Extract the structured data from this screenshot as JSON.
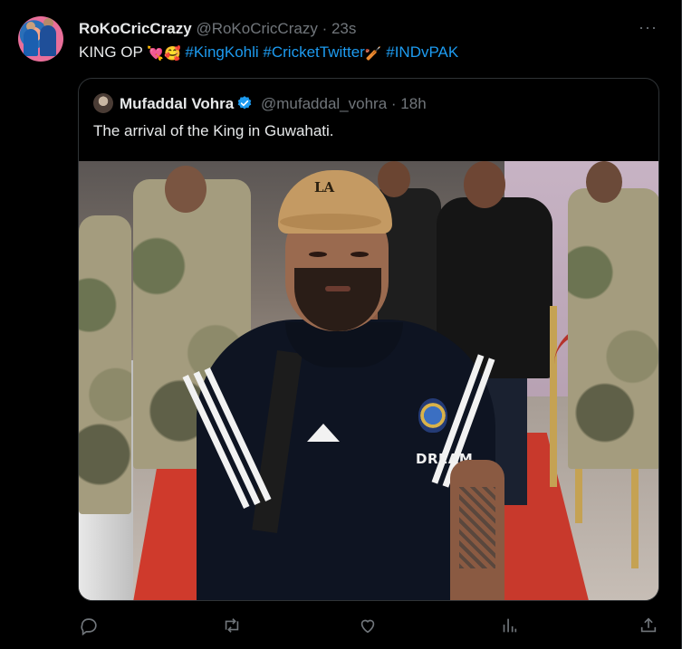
{
  "author": {
    "name": "RoKoCricCrazy",
    "handle": "@RoKoCricCrazy",
    "separator": "·",
    "time": "23s",
    "more": "···"
  },
  "tweet": {
    "text_prefix": "KING OP",
    "emoji1": "💘",
    "emoji2": "🥰",
    "hashtag1": "#KingKohli",
    "hashtag2": "#CricketTwitter",
    "emoji3": "🏏",
    "hashtag3": "#INDvPAK"
  },
  "quote": {
    "name": "Mufaddal Vohra",
    "handle": "@mufaddal_vohra",
    "separator": "·",
    "time": "18h",
    "text": "The arrival of the King in Guwahati.",
    "photo": {
      "cap_logo": "LA",
      "jersey_text": "DREAM"
    }
  },
  "colors": {
    "background": "#000000",
    "text": "#e7e9ea",
    "muted": "#71767b",
    "link": "#1d9bf0",
    "border": "#2f3336"
  },
  "actions": [
    "reply-icon",
    "retweet-icon",
    "like-icon",
    "views-icon",
    "share-icon"
  ]
}
